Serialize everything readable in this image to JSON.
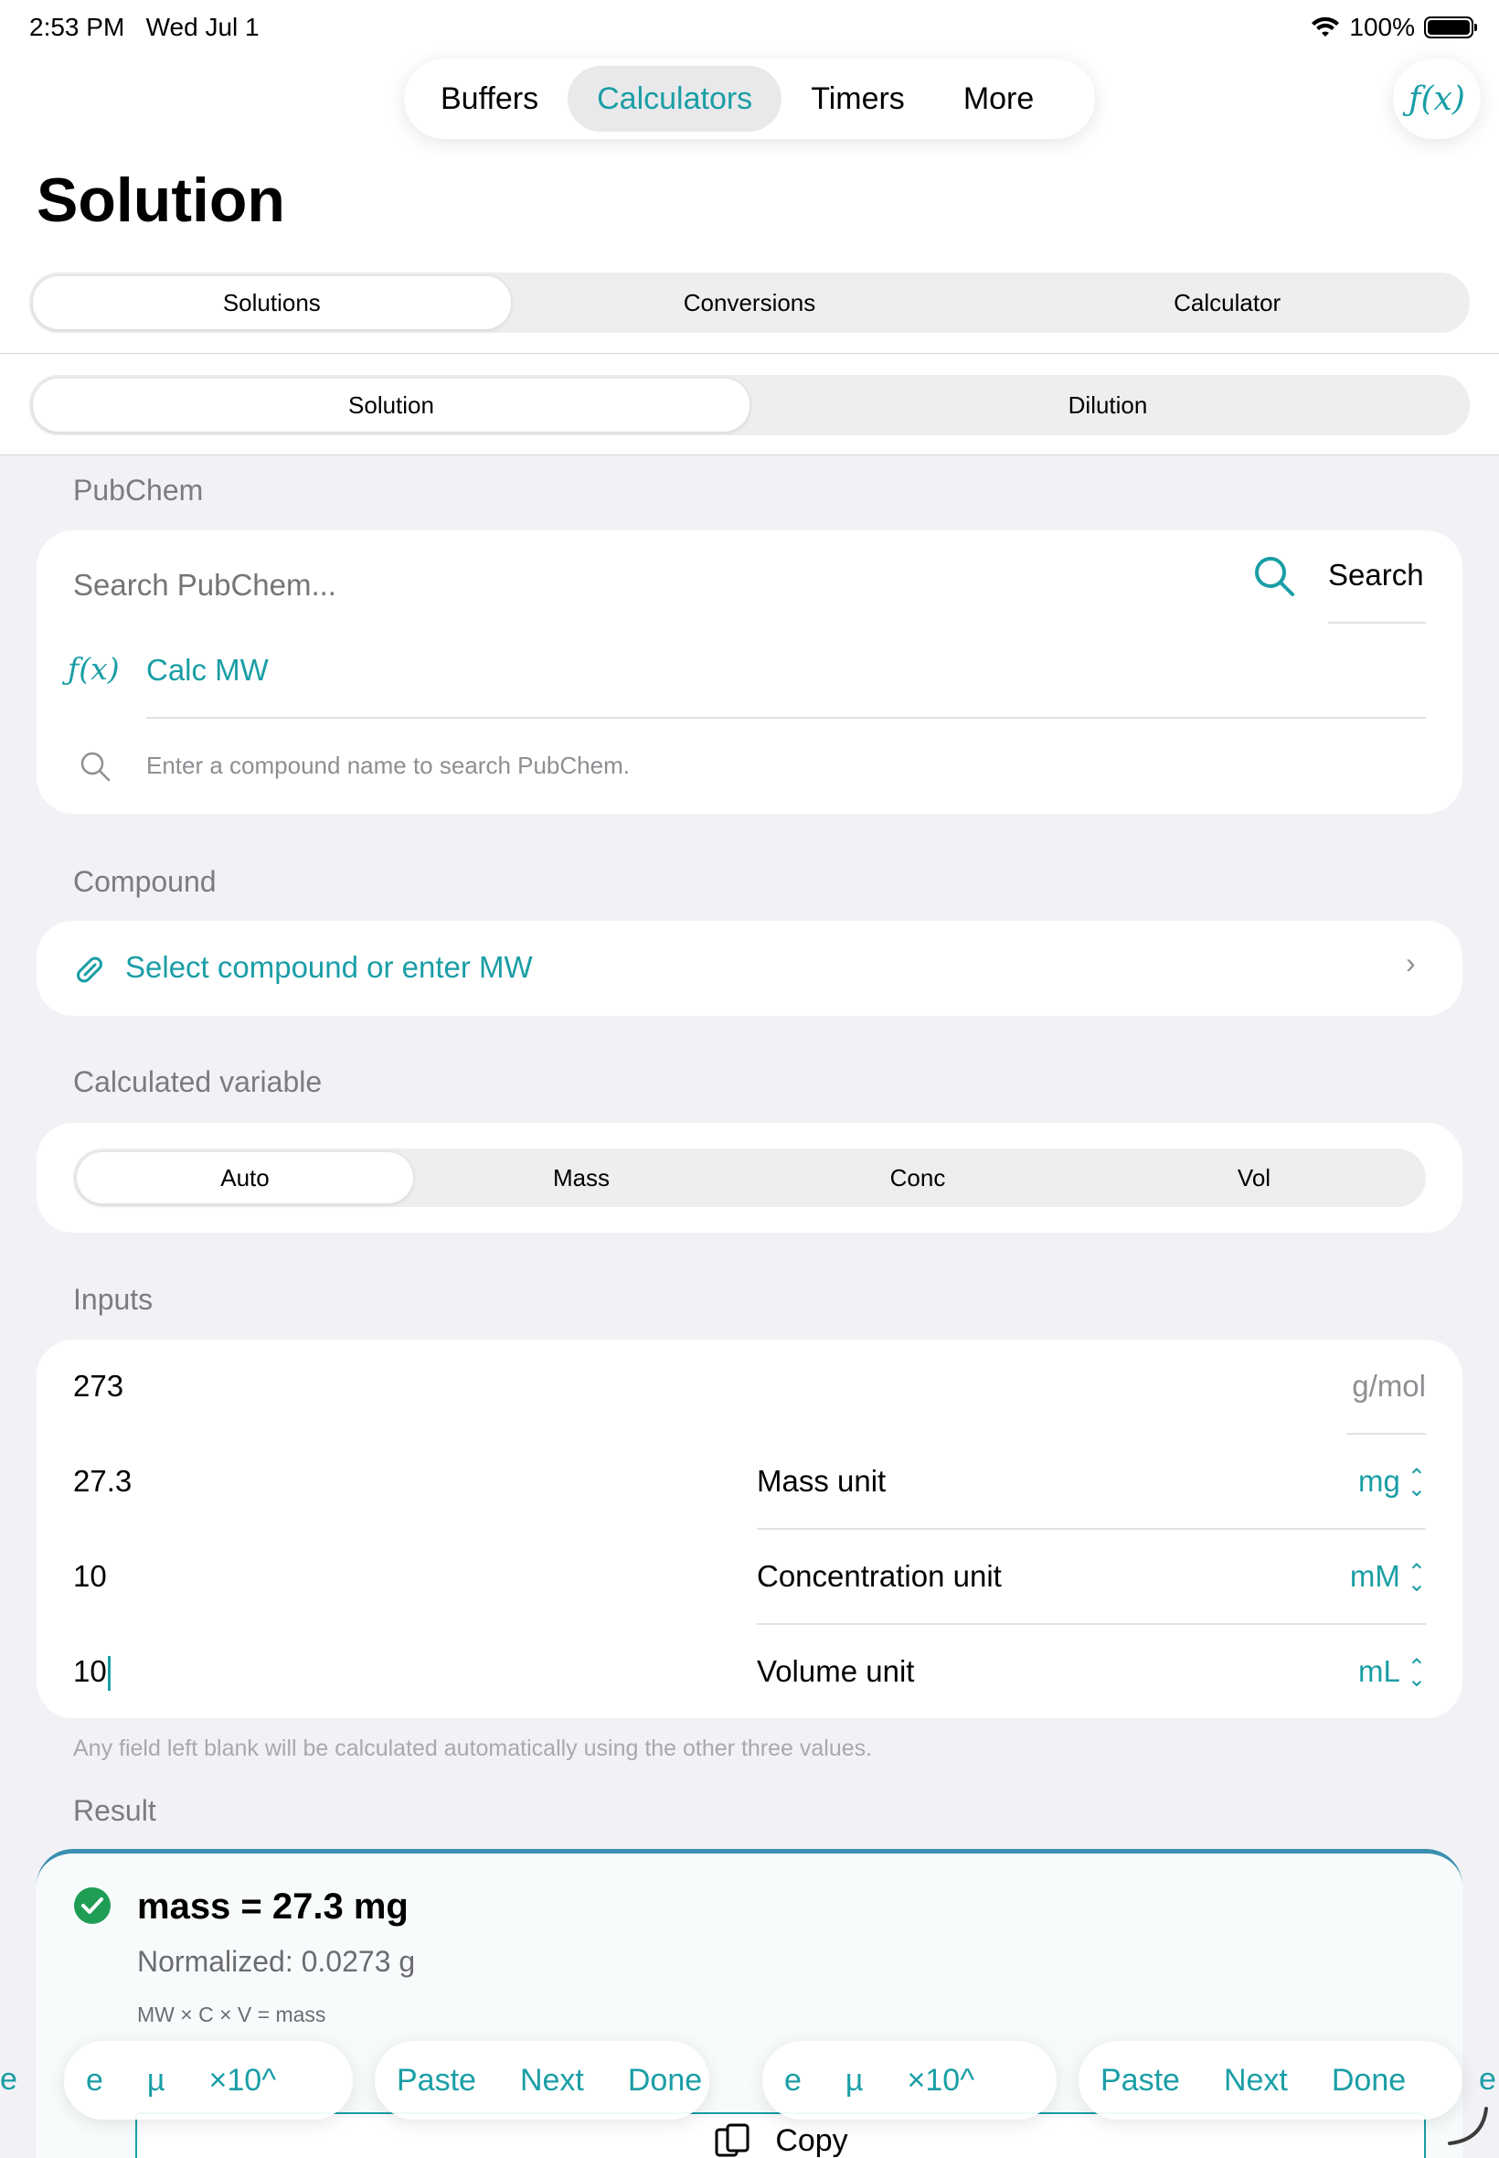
{
  "status_bar": {
    "time": "2:53 PM",
    "date": "Wed Jul 1",
    "battery": "100%"
  },
  "nav": {
    "tabs": [
      {
        "label": "Buffers",
        "active": false
      },
      {
        "label": "Calculators",
        "active": true
      },
      {
        "label": "Timers",
        "active": false
      },
      {
        "label": "More",
        "active": false
      }
    ],
    "fx_label": "ƒ(x)"
  },
  "page": {
    "title": "Solution"
  },
  "segments_top": [
    {
      "label": "Solutions",
      "selected": true
    },
    {
      "label": "Conversions",
      "selected": false
    },
    {
      "label": "Calculator",
      "selected": false
    }
  ],
  "segments_sub": [
    {
      "label": "Solution",
      "selected": true
    },
    {
      "label": "Dilution",
      "selected": false
    }
  ],
  "pubchem": {
    "header": "PubChem",
    "search_placeholder": "Search PubChem...",
    "search_button": "Search",
    "calc_mw_icon": "ƒ(x)",
    "calc_mw": "Calc MW",
    "hint": "Enter a compound name to search PubChem."
  },
  "compound": {
    "header": "Compound",
    "select_label": "Select compound or enter MW"
  },
  "calc_variable": {
    "header": "Calculated variable",
    "options": [
      {
        "label": "Auto",
        "selected": true
      },
      {
        "label": "Mass",
        "selected": false
      },
      {
        "label": "Conc",
        "selected": false
      },
      {
        "label": "Vol",
        "selected": false
      }
    ]
  },
  "inputs": {
    "header": "Inputs",
    "mw_value": "273",
    "mw_unit": "g/mol",
    "mass_value": "27.3",
    "mass_unit_label": "Mass unit",
    "mass_unit": "mg",
    "conc_value": "10",
    "conc_unit_label": "Concentration unit",
    "conc_unit": "mM",
    "vol_value": "10",
    "vol_unit_label": "Volume unit",
    "vol_unit": "mL",
    "footnote": "Any field left blank will be calculated automatically using the other three values."
  },
  "result": {
    "header": "Result",
    "main": "mass = 27.3 mg",
    "normalized": "Normalized: 0.0273 g",
    "formula": "MW × C × V = mass",
    "copy": "Copy"
  },
  "keyboard_bar": {
    "edge_e": "e",
    "group1": [
      "e",
      "µ",
      "×10^"
    ],
    "group2": [
      "Paste",
      "Next",
      "Done"
    ],
    "group3": [
      "e",
      "µ",
      "×10^"
    ],
    "group4": [
      "Paste",
      "Next",
      "Done"
    ],
    "edge_right": "e"
  },
  "colors": {
    "accent": "#1a9ea6",
    "success": "#1f9d55",
    "background": "#f2f2f6"
  }
}
